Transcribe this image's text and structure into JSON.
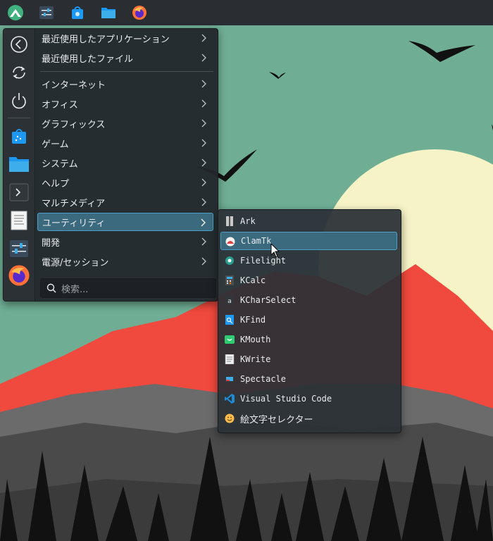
{
  "taskbar": {
    "icons": [
      "app-launcher-icon",
      "settings-icon",
      "discover-store-icon",
      "file-manager-icon",
      "firefox-icon"
    ]
  },
  "sidebar": {
    "buttons": [
      "back-icon",
      "restart-icon",
      "power-icon",
      "discover-icon",
      "folder-icon",
      "terminal-icon",
      "text-editor-icon",
      "settings-icon",
      "firefox-icon"
    ]
  },
  "menu": {
    "categories": [
      {
        "label": "最近使用したアプリケーション"
      },
      {
        "label": "最近使用したファイル"
      },
      {
        "label": "インターネット"
      },
      {
        "label": "オフィス"
      },
      {
        "label": "グラフィックス"
      },
      {
        "label": "ゲーム"
      },
      {
        "label": "システム"
      },
      {
        "label": "ヘルプ"
      },
      {
        "label": "マルチメディア"
      },
      {
        "label": "ユーティリティ"
      },
      {
        "label": "開発"
      },
      {
        "label": "電源/セッション"
      }
    ],
    "active_category": "ユーティリティ",
    "search_placeholder": "検索..."
  },
  "submenu": {
    "items": [
      {
        "label": "Ark",
        "icon": "ark-icon"
      },
      {
        "label": "ClamTk",
        "icon": "clamtk-icon"
      },
      {
        "label": "Filelight",
        "icon": "filelight-icon"
      },
      {
        "label": "KCalc",
        "icon": "kcalc-icon"
      },
      {
        "label": "KCharSelect",
        "icon": "kcharselect-icon"
      },
      {
        "label": "KFind",
        "icon": "kfind-icon"
      },
      {
        "label": "KMouth",
        "icon": "kmouth-icon"
      },
      {
        "label": "KWrite",
        "icon": "kwrite-icon"
      },
      {
        "label": "Spectacle",
        "icon": "spectacle-icon"
      },
      {
        "label": "Visual Studio Code",
        "icon": "vscode-icon"
      },
      {
        "label": "絵文字セレクター",
        "icon": "emoji-icon"
      }
    ],
    "hovered": "ClamTk"
  },
  "colors": {
    "sky": "#6fae95",
    "sun": "#f6f3c6",
    "mountain_red": "#f0493d",
    "mountain_dark": "#4a4a4a",
    "panel": "#2a2e32",
    "highlight": "#3b6a7f",
    "highlight_border": "#4aa0c8"
  }
}
